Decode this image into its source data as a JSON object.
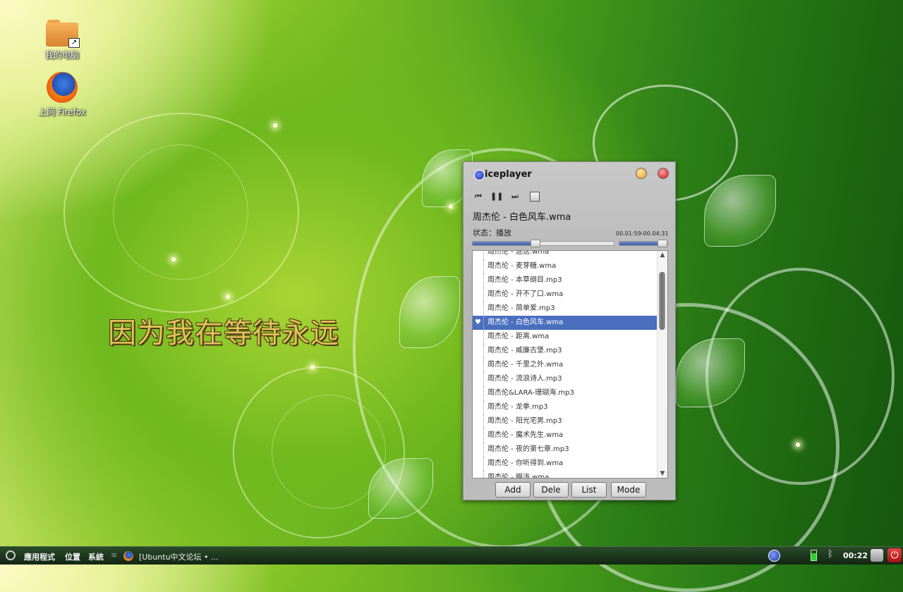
{
  "desktop": {
    "icons": [
      {
        "label": "我的电脑",
        "icon": "folder-icon"
      },
      {
        "label": "上网 Firefox",
        "icon": "firefox-icon"
      }
    ],
    "lyric": "因为我在等待永远"
  },
  "player": {
    "app_name": "iceplayer",
    "controls": {
      "prev": "⏮",
      "pause": "❚❚",
      "next": "⏭"
    },
    "now_playing": "周杰伦 - 白色风车.wma",
    "status": "状态：播放",
    "time": "00.01:59-00.04:31",
    "progress_fraction": 0.44,
    "volume_fraction": 0.88,
    "playlist": [
      "周杰伦 - 迷迭.wma",
      "周杰伦 - 麦芽糖.wma",
      "周杰伦 - 本草纲目.mp3",
      "周杰伦 - 开不了口.wma",
      "周杰伦 - 简单爱.mp3",
      "周杰伦 - 白色风车.wma",
      "周杰伦 - 距离.wma",
      "周杰伦 - 威廉古堡.mp3",
      "周杰伦 - 千里之外.wma",
      "周杰伦 - 流浪诗人.mp3",
      "周杰伦&LARA-珊瑚海.mp3",
      "周杰伦 - 龙拳.mp3",
      "周杰伦 - 阳光宅男.mp3",
      "周杰伦 - 魔术先生.wma",
      "周杰伦 - 夜的第七章.mp3",
      "周杰伦 - 你听得到.wma",
      "周杰伦 - 搁浅.wma"
    ],
    "selected_index": 5,
    "buttons": {
      "add": "Add",
      "dele": "Dele",
      "list": "List",
      "mode": "Mode"
    }
  },
  "taskbar": {
    "menu_apps": "應用程式",
    "menu_places": "位置",
    "menu_system": "系統",
    "separator": "≡",
    "task_title": "[Ubuntu中文论坛 • ...",
    "clock": "00:22",
    "bluetooth_glyph": "ᛒ",
    "power_glyph": "⏻"
  }
}
